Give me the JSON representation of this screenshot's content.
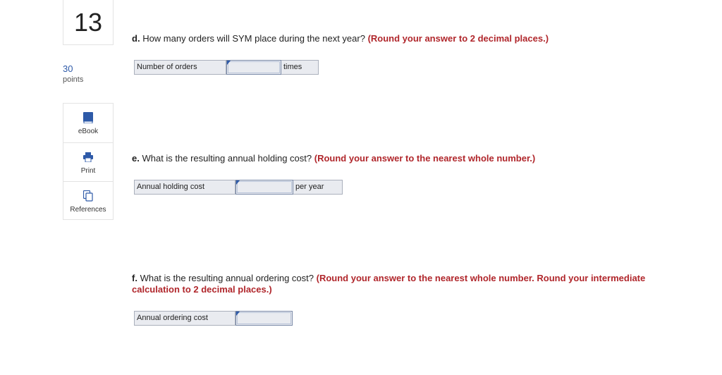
{
  "question": {
    "number": "13",
    "points_value": "30",
    "points_label": "points"
  },
  "tools": [
    {
      "label": "eBook",
      "icon": "book-icon"
    },
    {
      "label": "Print",
      "icon": "printer-icon"
    },
    {
      "label": "References",
      "icon": "references-icon"
    }
  ],
  "parts": {
    "d": {
      "letter": "d.",
      "text": "How many orders will SYM place during the next year?",
      "hint": "(Round your answer to 2 decimal places.)",
      "field_label": "Number of orders",
      "value": "",
      "unit": "times"
    },
    "e": {
      "letter": "e.",
      "text": "What is the resulting annual holding cost?",
      "hint": "(Round your answer to the nearest whole number.)",
      "field_label": "Annual holding cost",
      "value": "",
      "unit": "per year"
    },
    "f": {
      "letter": "f.",
      "text": "What is the resulting annual ordering cost?",
      "hint": "(Round your answer to the nearest whole number. Round your intermediate calculation to 2 decimal places.)",
      "field_label": "Annual ordering cost",
      "value": ""
    }
  },
  "colors": {
    "hint_red": "#b0262b",
    "accent_blue": "#2e5aa8",
    "field_bg": "#e9ebf0"
  }
}
